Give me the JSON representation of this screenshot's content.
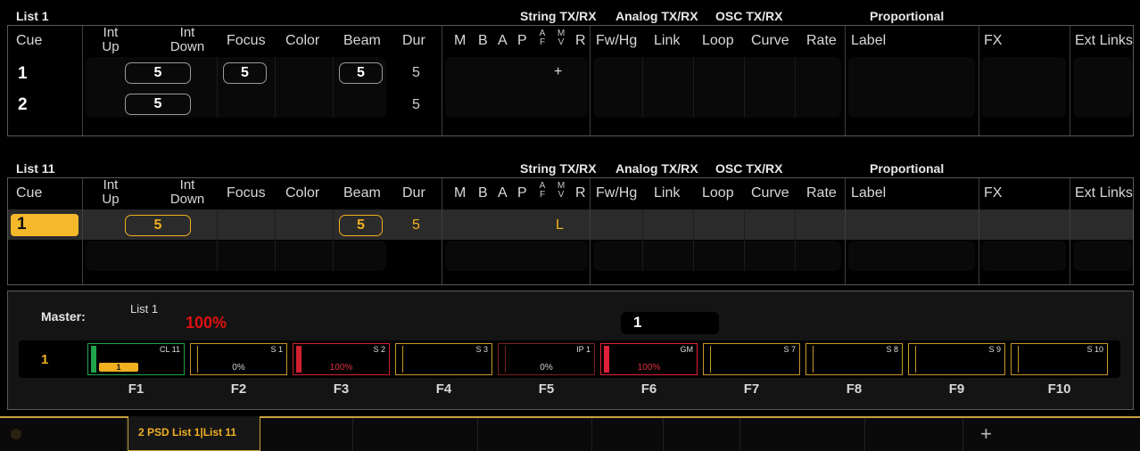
{
  "lists": [
    {
      "title": "List 1",
      "string_txrx": "String TX/RX",
      "analog_txrx": "Analog TX/RX",
      "osc_txrx": "OSC TX/RX",
      "proportional": "Proportional",
      "rows": [
        {
          "cue": "1",
          "int_up": "",
          "int_down": "5",
          "focus": "5",
          "color": "",
          "beam": "5",
          "dur": "5",
          "mv": "+"
        },
        {
          "cue": "2",
          "int_up": "",
          "int_down": "5",
          "focus": "",
          "color": "",
          "beam": "",
          "dur": "5",
          "mv": ""
        }
      ]
    },
    {
      "title": "List 11",
      "string_txrx": "String TX/RX",
      "analog_txrx": "Analog TX/RX",
      "osc_txrx": "OSC TX/RX",
      "proportional": "Proportional",
      "rows": [
        {
          "cue": "1",
          "int_up": "",
          "int_down": "5",
          "focus": "",
          "color": "",
          "beam": "5",
          "dur": "5",
          "mv": "L",
          "selected": true
        }
      ]
    }
  ],
  "columns": {
    "cue": "Cue",
    "int_up": [
      "Int",
      "Up"
    ],
    "int_down": [
      "Int",
      "Down"
    ],
    "focus": "Focus",
    "color": "Color",
    "beam": "Beam",
    "dur": "Dur",
    "m": "M",
    "b": "B",
    "a": "A",
    "p": "P",
    "af": [
      "A",
      "F"
    ],
    "mv": [
      "M",
      "V"
    ],
    "r": "R",
    "fwhg": "Fw/Hg",
    "link": "Link",
    "loop": "Loop",
    "curve": "Curve",
    "rate": "Rate",
    "label": "Label",
    "fx": "FX",
    "ext_links": "Ext Links"
  },
  "master": {
    "label": "Master:",
    "list": "List 1",
    "level": "100%",
    "cue_field": "1",
    "page": "1",
    "faders": [
      {
        "key": "F1",
        "label": "CL 11",
        "pct": "",
        "value": "1",
        "level": 1.0,
        "color": "#1fa54a"
      },
      {
        "key": "F2",
        "label": "S 1",
        "pct": "0%",
        "level": 0,
        "color": "#c8962a"
      },
      {
        "key": "F3",
        "label": "S 2",
        "pct": "100%",
        "level": 1.0,
        "color": "#d02030"
      },
      {
        "key": "F4",
        "label": "S 3",
        "pct": "",
        "level": 0,
        "color": "#c8962a"
      },
      {
        "key": "F5",
        "label": "IP 1",
        "pct": "0%",
        "level": 0,
        "color": "#7a2020"
      },
      {
        "key": "F6",
        "label": "GM",
        "pct": "100%",
        "level": 1.0,
        "color": "#e0203a"
      },
      {
        "key": "F7",
        "label": "S 7",
        "pct": "",
        "level": 0,
        "color": "#c8962a"
      },
      {
        "key": "F8",
        "label": "S 8",
        "pct": "",
        "level": 0,
        "color": "#c8962a"
      },
      {
        "key": "F9",
        "label": "S 9",
        "pct": "",
        "level": 0,
        "color": "#c8962a"
      },
      {
        "key": "F10",
        "label": "S 10",
        "pct": "",
        "level": 0,
        "color": "#c8962a"
      }
    ]
  },
  "tabs": {
    "active": "2 PSD List 1|List 11",
    "add": "+"
  },
  "colors": {
    "accent": "#f0b020",
    "alert": "#e01010",
    "panel_border": "#5a5a5a"
  }
}
